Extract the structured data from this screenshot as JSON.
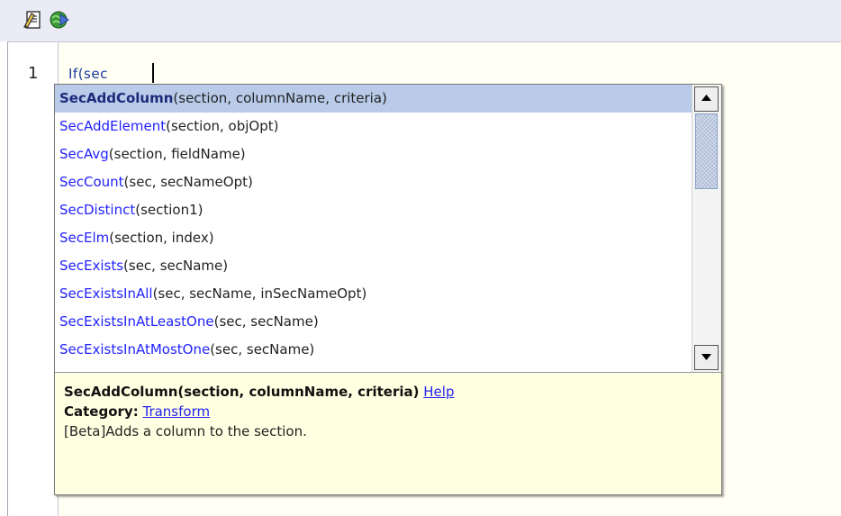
{
  "toolbar": {
    "buttons": [
      {
        "icon": "edit-document-icon"
      },
      {
        "icon": "run-globe-icon"
      }
    ]
  },
  "editor": {
    "line_number": "1",
    "code_text": "If(sec"
  },
  "autocomplete": {
    "items": [
      {
        "name": "SecAddColumn",
        "args": "(section, columnName, criteria)",
        "selected": true
      },
      {
        "name": "SecAddElement",
        "args": "(section, objOpt)"
      },
      {
        "name": "SecAvg",
        "args": "(section, fieldName)"
      },
      {
        "name": "SecCount",
        "args": "(sec, secNameOpt)"
      },
      {
        "name": "SecDistinct",
        "args": "(section1)"
      },
      {
        "name": "SecElm",
        "args": "(section, index)"
      },
      {
        "name": "SecExists",
        "args": "(sec, secName)"
      },
      {
        "name": "SecExistsInAll",
        "args": "(sec, secName, inSecNameOpt)"
      },
      {
        "name": "SecExistsInAtLeastOne",
        "args": "(sec, secName)"
      },
      {
        "name": "SecExistsInAtMostOne",
        "args": "(sec, secName)"
      }
    ],
    "detail": {
      "signature": "SecAddColumn(section, columnName, criteria)",
      "help_link": "Help",
      "category_label": "Category:",
      "category_value": "Transform",
      "description": "[Beta]Adds a column to the section."
    }
  },
  "colors": {
    "toolbar_bg": "#ebebf5",
    "code_bg": "#fffff4",
    "selected_row": "#b9cbe9",
    "function_name": "#2222ff",
    "detail_bg": "#ffffe1"
  }
}
